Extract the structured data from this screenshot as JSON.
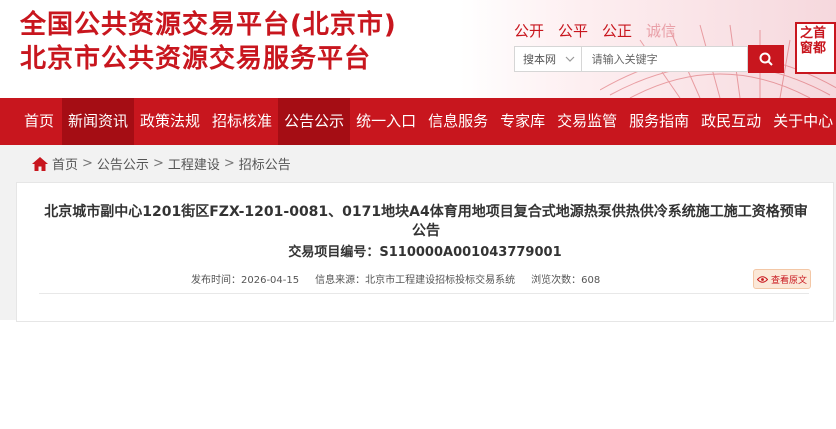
{
  "header": {
    "title_line1": "全国公共资源交易平台(北京市)",
    "title_line2": "北京市公共资源交易服务平台",
    "slogans": [
      "公开",
      "公平",
      "公正"
    ],
    "slogan_faint": "诚信",
    "search": {
      "scope": "搜本网",
      "placeholder": "请输入关键字"
    },
    "logo_text": "之首都窗"
  },
  "nav": {
    "items": [
      "首页",
      "新闻资讯",
      "政策法规",
      "招标核准",
      "公告公示",
      "统一入口",
      "信息服务",
      "专家库",
      "交易监管",
      "服务指南",
      "政民互动",
      "关于中心"
    ]
  },
  "breadcrumb": [
    "首页",
    "公告公示",
    "工程建设",
    "招标公告"
  ],
  "notice": {
    "title": "北京城市副中心1201街区FZX-1201-0081、0171地块A4体育用地项目复合式地源热泵供热供冷系统施工施工资格预审公告",
    "project_no": "交易项目编号：S110000A001043779001",
    "publish_label": "发布时间：",
    "publish_date": "2026-04-15",
    "source_label": "信息来源：",
    "source": "北京市工程建设招标投标交易系统",
    "views_label": "浏览次数：",
    "views": "608",
    "view_original": "查看原文"
  },
  "colors": {
    "brand_red": "#c8161e",
    "nav_active": "#a50d14"
  }
}
